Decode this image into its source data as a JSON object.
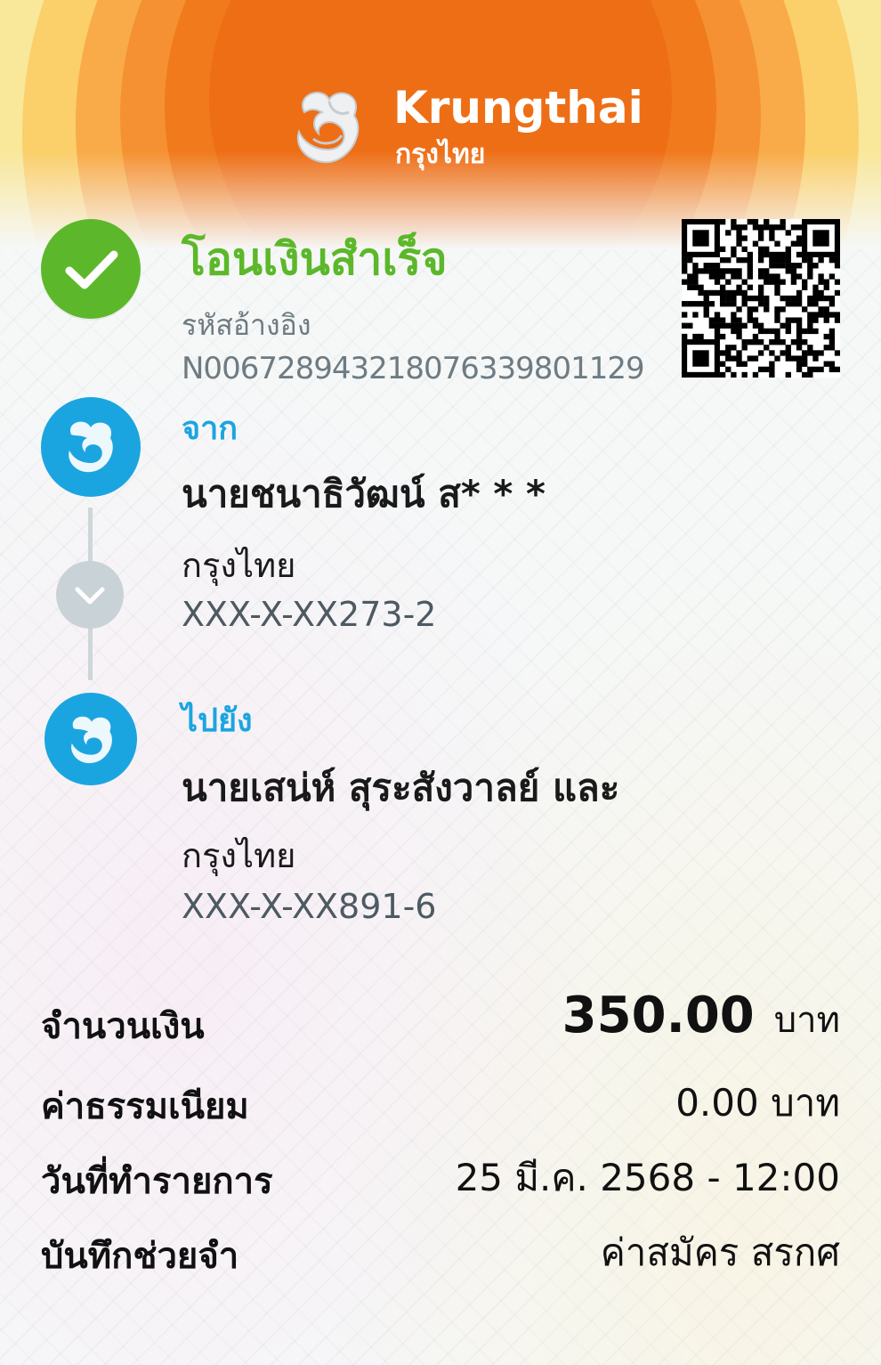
{
  "header": {
    "brand_en": "Krungthai",
    "brand_th": "กรุงไทย"
  },
  "status": {
    "title": "โอนเงินสำเร็จ",
    "ref_label": "รหัสอ้างอิง",
    "ref_value": "N006728943218076339801129"
  },
  "from": {
    "label": "จาก",
    "name": "นายชนาธิวัฒน์ ส* * *",
    "bank": "กรุงไทย",
    "account": "XXX-X-XX273-2"
  },
  "to": {
    "label": "ไปยัง",
    "name": "นายเสน่ห์ สุระสังวาลย์ และ",
    "bank": "กรุงไทย",
    "account": "XXX-X-XX891-6"
  },
  "details": {
    "amount_label": "จำนวนเงิน",
    "amount_value": "350.00",
    "amount_unit": "บาท",
    "fee_label": "ค่าธรรมเนียม",
    "fee_value": "0.00 บาท",
    "date_label": "วันที่ทำรายการ",
    "date_value": "25 มี.ค. 2568 - 12:00",
    "memo_label": "บันทึกช่วยจำ",
    "memo_value": "ค่าสมัคร สรกศ"
  },
  "colors": {
    "success_green": "#5cb82a",
    "brand_blue": "#1ba5e0",
    "header_orange": "#f07a1c"
  },
  "icons": [
    "check-icon",
    "qr-code-icon",
    "bank-emblem-icon",
    "chevron-down-icon"
  ]
}
